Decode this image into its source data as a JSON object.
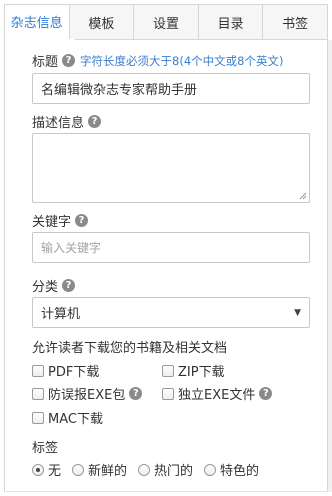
{
  "tabs": [
    {
      "label": "杂志信息",
      "active": true
    },
    {
      "label": "模板",
      "active": false
    },
    {
      "label": "设置",
      "active": false
    },
    {
      "label": "目录",
      "active": false
    },
    {
      "label": "书签",
      "active": false
    }
  ],
  "title_field": {
    "label": "标题",
    "hint": "字符长度必须大于8(4个中文或8个英文)",
    "value": "名编辑微杂志专家帮助手册"
  },
  "description_field": {
    "label": "描述信息",
    "value": ""
  },
  "keyword_field": {
    "label": "关键字",
    "placeholder": "输入关键字"
  },
  "category_field": {
    "label": "分类",
    "selected": "计算机"
  },
  "downloads": {
    "label": "允许读者下载您的书籍及相关文档",
    "options": [
      "PDF下载",
      "ZIP下载",
      "防误报EXE包",
      "独立EXE文件",
      "MAC下载"
    ]
  },
  "tags": {
    "label": "标签",
    "options": [
      "无",
      "新鲜的",
      "热门的",
      "特色的"
    ],
    "selected": "无"
  },
  "icons": {
    "help": "?",
    "caret": "▼"
  },
  "colors": {
    "accent": "#2f7bd6",
    "hint": "#3a7fd0",
    "help_icon": "#8a8a8a"
  }
}
